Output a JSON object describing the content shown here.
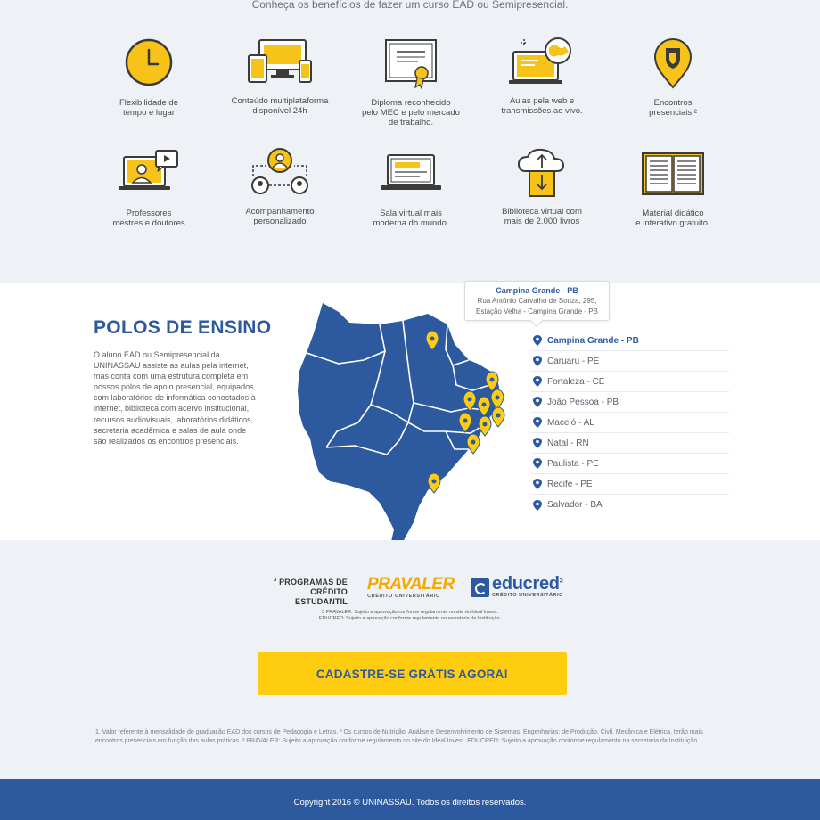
{
  "colors": {
    "brand_blue": "#2d5a9f",
    "accent_yellow": "#fecd0f",
    "icon_yellow": "#f7c318",
    "icon_stroke": "#3b3b3b"
  },
  "benefits": {
    "intro": "Conheça os benefícios de fazer um curso EAD ou Semipresencial.",
    "items": [
      {
        "icon": "clock-icon",
        "label": "Flexibilidade de\ntempo e lugar"
      },
      {
        "icon": "devices-icon",
        "label": "Conteúdo multiplataforma\ndisponível 24h"
      },
      {
        "icon": "diploma-icon",
        "label": "Diploma reconhecido\npelo MEC e pelo mercado\nde  trabalho."
      },
      {
        "icon": "web-classes-icon",
        "label": "Aulas pela web e\ntransmissões ao vivo."
      },
      {
        "icon": "location-shield-icon",
        "label": "Encontros\npresenciais.²"
      },
      {
        "icon": "teacher-video-icon",
        "label": "Professores\nmestres e doutores"
      },
      {
        "icon": "mentoring-icon",
        "label": "Acompanhamento\npersonalizado"
      },
      {
        "icon": "virtual-room-icon",
        "label": "Sala virtual mais\nmoderna do mundo."
      },
      {
        "icon": "cloud-library-icon",
        "label": "Biblioteca virtual com\nmais de 2.000 livros"
      },
      {
        "icon": "book-icon",
        "label": "Material didático\ne interativo gratuito."
      }
    ]
  },
  "polos": {
    "title": "POLOS DE ENSINO",
    "description": "O aluno EAD ou Semipresencial da UNINASSAU assiste as aulas pela internet, mas conta com uma estrutura completa em nossos polos de apoio presencial, equipados com laboratórios de informática conectados à internet, biblioteca com acervo institucional, recursos audiovisuais, laboratórios didáticos, secretaria acadêmica e salas de aula onde são realizados os encontros presenciais.",
    "tooltip": {
      "title": "Campina Grande - PB",
      "address_line1": "Rua Antônio Carvalho de Souza, 295,",
      "address_line2": "Estação Velha - Campina Grande - PB"
    },
    "campuses": [
      {
        "name": "Campina Grande - PB",
        "active": true
      },
      {
        "name": "Caruaru - PE",
        "active": false
      },
      {
        "name": "Fortaleza - CE",
        "active": false
      },
      {
        "name": "João Pessoa - PB",
        "active": false
      },
      {
        "name": "Maceió - AL",
        "active": false
      },
      {
        "name": "Natal - RN",
        "active": false
      },
      {
        "name": "Paulista - PE",
        "active": false
      },
      {
        "name": "Recife - PE",
        "active": false
      },
      {
        "name": "Salvador - BA",
        "active": false
      }
    ]
  },
  "credit": {
    "programs_label_sup": "3",
    "programs_label_line1": "PROGRAMAS DE",
    "programs_label_line2": "CRÉDITO ESTUDANTIL",
    "pravaler_name": "PRAVALER",
    "pravaler_sub": "CRÉDITO UNIVERSITÁRIO",
    "educred_name": "educred",
    "educred_sup": "3",
    "educred_sub": "CRÉDITO UNIVERSITÁRIO",
    "notes": "3 PRAVALER: Sujeito a aprovação conforme regulamento no site do Ideal Invest.\nEDUCRED: Sujeito a aprovação conforme regulamento na secretaria da Instituição."
  },
  "cta": {
    "label": "CADASTRE-SE GRÁTIS AGORA!"
  },
  "footnote": "1. Valor referente à mensalidade de graduação EAD dos cursos de Pedagogia e Letras. ² Os cursos de Nutrição, Análise e Desenvolvimento de Sistemas, Engenharias: de Produção, Civil, Mecânica e Elétrica, terão mais encontros presenciais em função das aulas práticas. ³ PRAVALER: Sujeito a aprovação conforme regulamento no site do Ideal Invest. EDUCRED: Sujeito a aprovação conforme regulamento na secretaria da Instituição.",
  "footer": {
    "copyright": "Copyright 2016 © UNINASSAU. Todos os direitos reservados."
  }
}
